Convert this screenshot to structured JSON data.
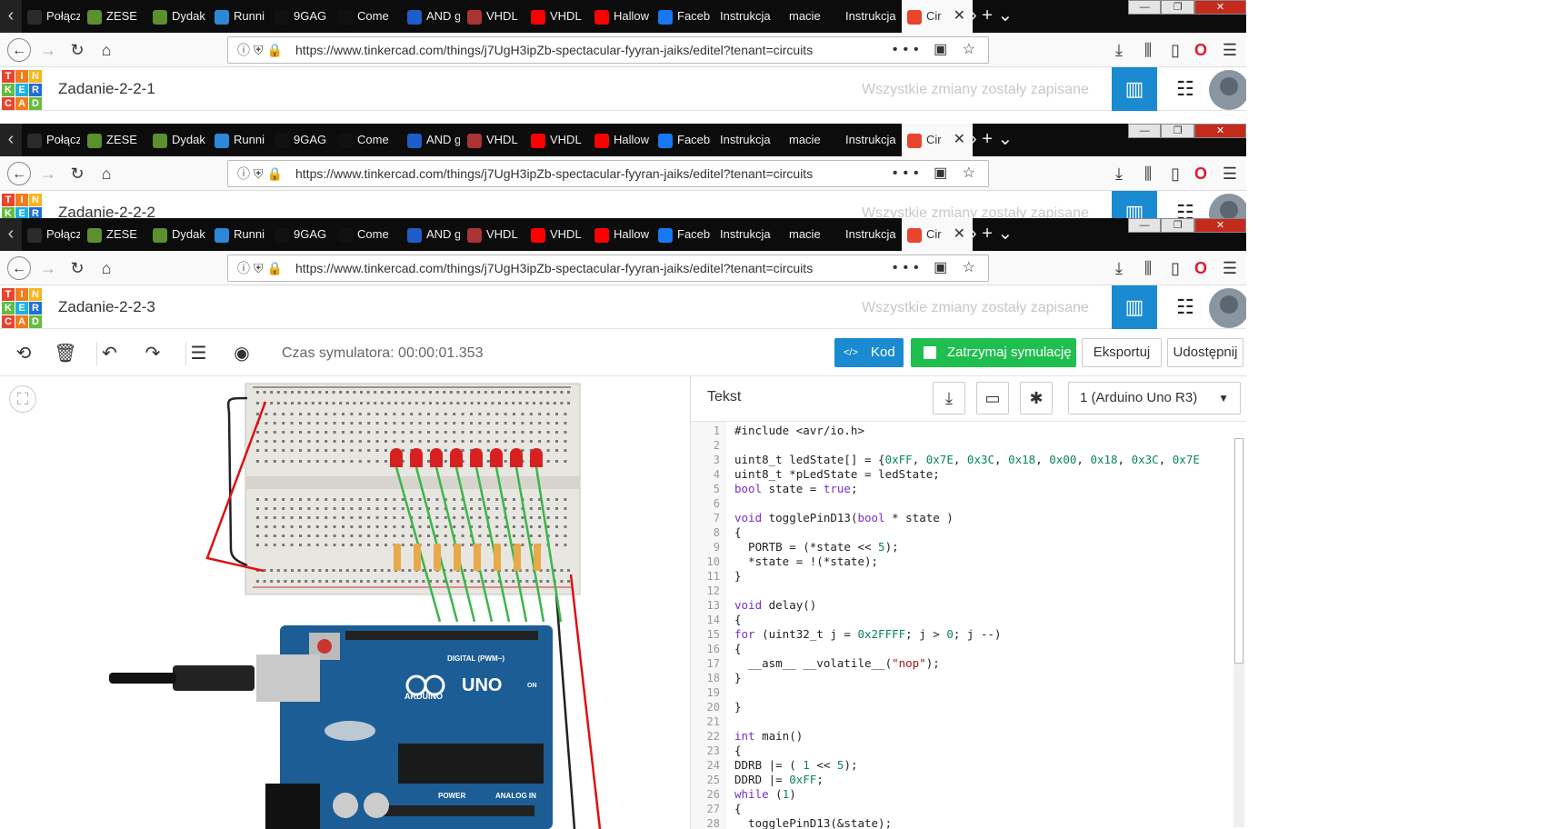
{
  "tabs": [
    {
      "label": "Połącz",
      "icon": "plug-icon",
      "color": "#2b2b2b"
    },
    {
      "label": "ZESE",
      "icon": "globe-icon",
      "color": "#5c8f2e"
    },
    {
      "label": "Dydak",
      "icon": "globe-icon",
      "color": "#5c8f2e"
    },
    {
      "label": "Runni",
      "icon": "vscode-icon",
      "color": "#2b88d8"
    },
    {
      "label": "9GAG",
      "icon": "9gag-icon",
      "color": "#111111"
    },
    {
      "label": "Come",
      "icon": "comedy-icon",
      "color": "#111111"
    },
    {
      "label": "AND g",
      "icon": "person-icon",
      "color": "#1e5cc9"
    },
    {
      "label": "VHDL",
      "icon": "grid-icon",
      "color": "#aa3333"
    },
    {
      "label": "VHDL",
      "icon": "youtube-icon",
      "color": "#ff0000"
    },
    {
      "label": "Hallow",
      "icon": "youtube-icon",
      "color": "#ff0000"
    },
    {
      "label": "Faceb",
      "icon": "facebook-icon",
      "color": "#1877f2"
    },
    {
      "label": "Instrukcja",
      "icon": "",
      "color": ""
    },
    {
      "label": "macie",
      "icon": "",
      "color": ""
    },
    {
      "label": "Instrukcja",
      "icon": "",
      "color": ""
    },
    {
      "label": "Cir",
      "icon": "tinkercad-icon",
      "color": "#e8442e"
    }
  ],
  "url": "https://www.tinkercad.com/things/j7UgH3ipZb-spectacular-fyyran-jaiks/editel?tenant=circuits",
  "windows": [
    {
      "project": "Zadanie-2-2-1"
    },
    {
      "project": "Zadanie-2-2-2"
    },
    {
      "project": "Zadanie-2-2-3"
    }
  ],
  "saved_status": "Wszystkie zmiany zostały zapisane",
  "logo_letters": [
    "T",
    "I",
    "N",
    "K",
    "E",
    "R",
    "C",
    "A",
    "D"
  ],
  "logo_colors": [
    "#e8442e",
    "#f27c1d",
    "#f9b41b",
    "#65bc3f",
    "#1ab2e8",
    "#1d6fd6",
    "#e8442e",
    "#f27c1d",
    "#65bc3f"
  ],
  "sim_time": "Czas symulatora: 00:00:01.353",
  "buttons": {
    "code": "Kod",
    "stop": "Zatrzymaj symulację",
    "export": "Eksportuj",
    "share": "Udostępnij"
  },
  "code_panel": {
    "title": "Tekst",
    "device": "1 (Arduino Uno R3)"
  },
  "board": {
    "digital_label": "DIGITAL (PWM~)",
    "brand": "ARDUINO",
    "model": "UNO",
    "power_label": "POWER",
    "analog_label": "ANALOG IN",
    "on_label": "ON"
  },
  "code_lines": [
    {
      "n": "1",
      "t": "#include <avr/io.h>"
    },
    {
      "n": "2",
      "t": ""
    },
    {
      "n": "3",
      "t": "uint8_t ledState[] = {0xFF, 0x7E, 0x3C, 0x18, 0x00, 0x18, 0x3C, 0x7E"
    },
    {
      "n": "4",
      "t": "uint8_t *pLedState = ledState;"
    },
    {
      "n": "5",
      "t": "bool state = true;"
    },
    {
      "n": "6",
      "t": ""
    },
    {
      "n": "7",
      "t": "void togglePinD13(bool * state )"
    },
    {
      "n": "8",
      "t": "{"
    },
    {
      "n": "9",
      "t": "  PORTB = (*state << 5);"
    },
    {
      "n": "10",
      "t": "  *state = !(*state);"
    },
    {
      "n": "11",
      "t": "}"
    },
    {
      "n": "12",
      "t": ""
    },
    {
      "n": "13",
      "t": "void delay()"
    },
    {
      "n": "14",
      "t": "{"
    },
    {
      "n": "15",
      "t": "for (uint32_t j = 0x2FFFF; j > 0; j --)"
    },
    {
      "n": "16",
      "t": "{"
    },
    {
      "n": "17",
      "t": "  __asm__ __volatile__(\"nop\");"
    },
    {
      "n": "18",
      "t": "}"
    },
    {
      "n": "19",
      "t": ""
    },
    {
      "n": "20",
      "t": "}"
    },
    {
      "n": "21",
      "t": ""
    },
    {
      "n": "22",
      "t": "int main()"
    },
    {
      "n": "23",
      "t": "{"
    },
    {
      "n": "24",
      "t": "DDRB |= ( 1 << 5);"
    },
    {
      "n": "25",
      "t": "DDRD |= 0xFF;"
    },
    {
      "n": "26",
      "t": "while (1)"
    },
    {
      "n": "27",
      "t": "{"
    },
    {
      "n": "28",
      "t": "  togglePinD13(&state);"
    }
  ]
}
